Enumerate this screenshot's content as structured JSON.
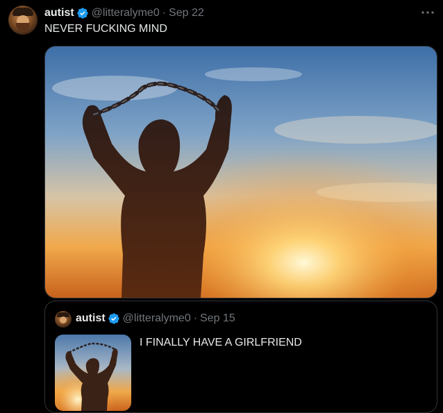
{
  "tweet": {
    "author_name": "autist",
    "handle": "@litteralyme0",
    "separator": "·",
    "date": "Sep 22",
    "text": "NEVER FUCKING MIND",
    "more_icon": "ellipsis-icon"
  },
  "quoted_tweet": {
    "author_name": "autist",
    "handle": "@litteralyme0",
    "separator": "·",
    "date": "Sep 15",
    "text": "I FINALLY HAVE A GIRLFRIEND"
  },
  "colors": {
    "background": "#000000",
    "text": "#e7e9ea",
    "muted": "#71767b",
    "verified": "#1d9bf0",
    "border": "#2f3336"
  }
}
